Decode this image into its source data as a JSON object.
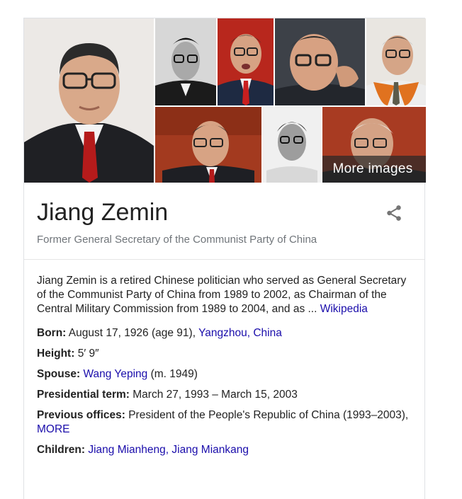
{
  "more_images_label": "More images",
  "title": "Jiang Zemin",
  "subtitle": "Former General Secretary of the Communist Party of China",
  "description": {
    "text": "Jiang Zemin is a retired Chinese politician who served as General Secretary of the Communist Party of China from 1989 to 2002, as Chairman of the Central Military Commission from 1989 to 2004, and as ...",
    "source_link": "Wikipedia"
  },
  "facts": {
    "born": {
      "label": "Born:",
      "value": " August 17, 1926 (age 91), ",
      "link": "Yangzhou, China"
    },
    "height": {
      "label": "Height:",
      "value": " 5′ 9″"
    },
    "spouse": {
      "label": "Spouse:",
      "link": "Wang Yeping",
      "value": " (m. 1949)"
    },
    "term": {
      "label": "Presidential term:",
      "value": " March 27, 1993 – March 15, 2003"
    },
    "offices": {
      "label": "Previous offices:",
      "value": " President of the People's Republic of China (1993–2003), ",
      "link": "MORE"
    },
    "children": {
      "label": "Children:",
      "link1": "Jiang Mianheng",
      "sep": ", ",
      "link2": "Jiang Miankang"
    }
  },
  "colors": {
    "link": "#1a0dab",
    "subtitle": "#70757a",
    "icon": "#757575"
  },
  "icons": {
    "share": "share-icon"
  }
}
